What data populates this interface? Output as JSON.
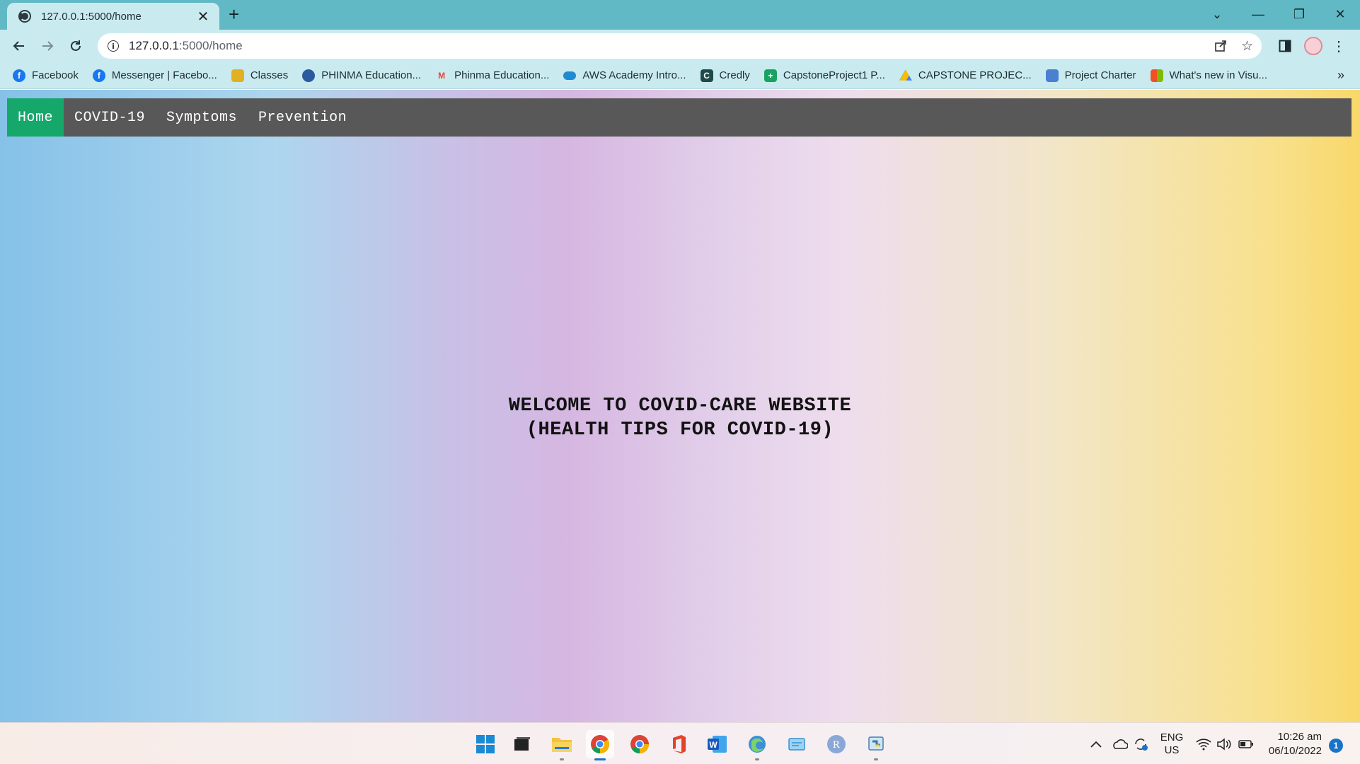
{
  "browser": {
    "tab": {
      "title": "127.0.0.1:5000/home",
      "close": "✕"
    },
    "new_tab": "+",
    "window_controls": {
      "tabs_menu": "⌄",
      "minimize": "—",
      "restore": "❐",
      "close": "✕"
    },
    "address": {
      "host": "127.0.0.1",
      "path": ":5000/home"
    },
    "bookmarks": [
      {
        "label": "Facebook",
        "icon": "facebook-icon",
        "color": "#1877f2",
        "glyph": "f"
      },
      {
        "label": "Messenger | Facebo...",
        "icon": "facebook-icon",
        "color": "#1877f2",
        "glyph": "f"
      },
      {
        "label": "Classes",
        "icon": "classroom-icon",
        "color": "#e2b123",
        "glyph": ""
      },
      {
        "label": "PHINMA Education...",
        "icon": "globe-icon",
        "color": "#2c5aa0",
        "glyph": ""
      },
      {
        "label": "Phinma Education...",
        "icon": "gmail-icon",
        "color": "#ea4335",
        "glyph": "M"
      },
      {
        "label": "AWS Academy Intro...",
        "icon": "cloud-icon",
        "color": "#1f8ad1",
        "glyph": ""
      },
      {
        "label": "Credly",
        "icon": "credly-icon",
        "color": "#1f4a4a",
        "glyph": "C"
      },
      {
        "label": "CapstoneProject1 P...",
        "icon": "sheets-icon",
        "color": "#1aa260",
        "glyph": "+"
      },
      {
        "label": "CAPSTONE PROJEC...",
        "icon": "drive-icon",
        "color": "#fbbc04",
        "glyph": ""
      },
      {
        "label": "Project Charter",
        "icon": "contacts-icon",
        "color": "#4a7fd1",
        "glyph": ""
      },
      {
        "label": "What's new in Visu...",
        "icon": "microsoft-icon",
        "color": "#f25022",
        "glyph": ""
      }
    ],
    "bookmarks_more": "»"
  },
  "site": {
    "nav": [
      {
        "label": "Home",
        "active": true
      },
      {
        "label": "COVID-19",
        "active": false
      },
      {
        "label": "Symptoms",
        "active": false
      },
      {
        "label": "Prevention",
        "active": false
      }
    ],
    "hero_line1": "WELCOME TO COVID-CARE WEBSITE",
    "hero_line2": "(HEALTH TIPS FOR COVID-19)"
  },
  "taskbar": {
    "language": "ENG",
    "region": "US",
    "time": "10:26 am",
    "date": "06/10/2022",
    "notifications": "1"
  }
}
